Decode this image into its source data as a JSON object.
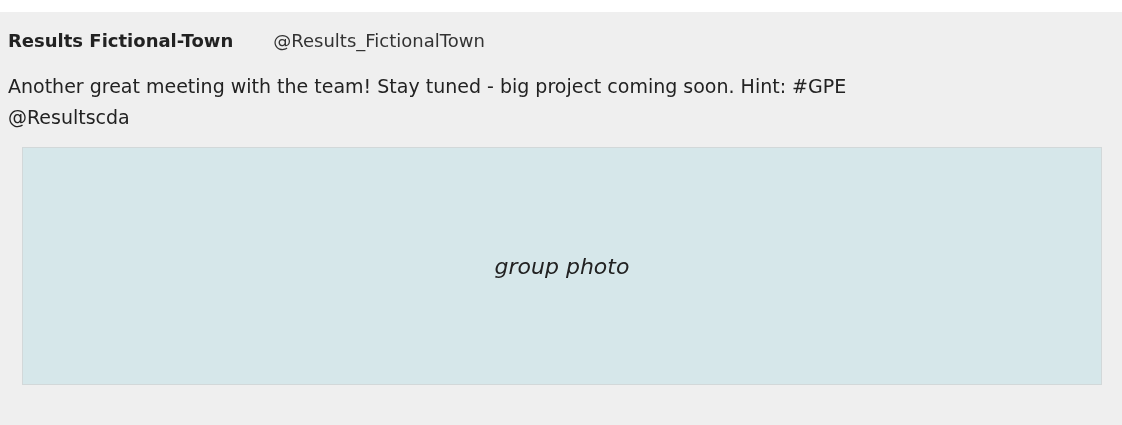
{
  "post": {
    "author": "Results Fictional-Town",
    "handle": "@Results_FictionalTown",
    "text": "Another great meeting with the team! Stay tuned - big project coming soon. Hint: #GPE @Resultscda",
    "photo": {
      "caption": "group photo"
    }
  }
}
